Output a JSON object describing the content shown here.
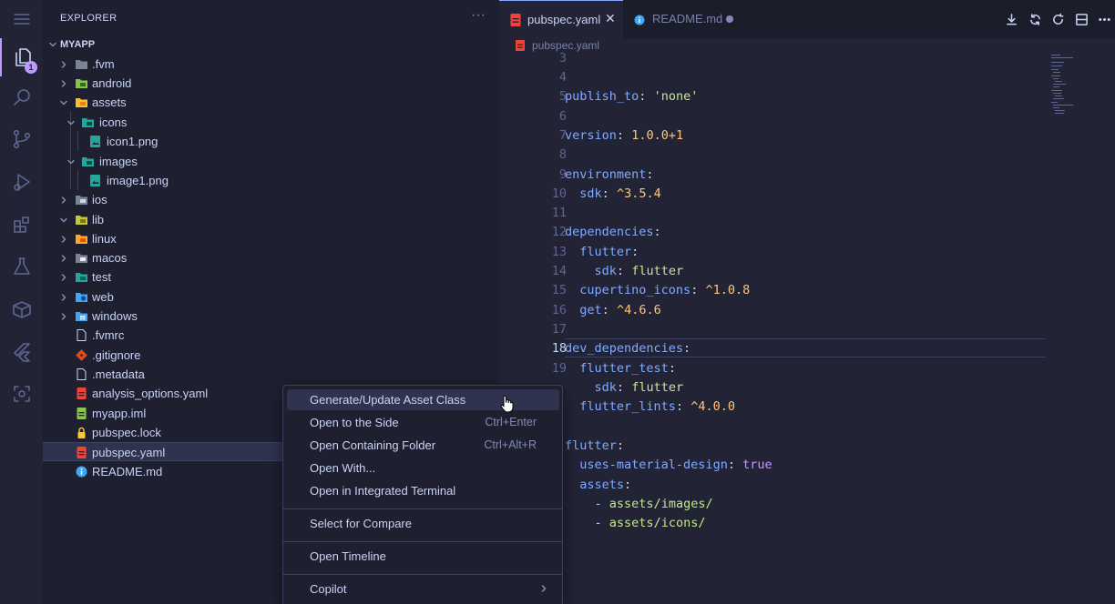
{
  "sidebar": {
    "title": "EXPLORER",
    "more": "···",
    "project": "MYAPP",
    "rows": [
      {
        "label": "assets"
      },
      {
        "label": "icons"
      },
      {
        "label": "icon1.png"
      },
      {
        "label": "images"
      },
      {
        "label": "image1.png"
      }
    ],
    "tree": {
      "fvm": ".fvm",
      "android": "android",
      "assets": "assets",
      "icons": "icons",
      "icon1": "icon1.png",
      "images": "images",
      "image1": "image1.png",
      "ios": "ios",
      "lib": "lib",
      "linux": "linux",
      "macos": "macos",
      "test": "test",
      "web": "web",
      "windows": "windows",
      "fvmrc": ".fvmrc",
      "gitignore": ".gitignore",
      "metadata": ".metadata",
      "analysis": "analysis_options.yaml",
      "myapp_iml": "myapp.iml",
      "pubspec_lock": "pubspec.lock",
      "pubspec_yaml": "pubspec.yaml",
      "readme": "README.md"
    }
  },
  "activity": {
    "badge": "1"
  },
  "tabs": {
    "t1": "pubspec.yaml",
    "t2": "README.md",
    "close": "✕"
  },
  "breadcrumb": "pubspec.yaml",
  "code": {
    "l3": "3",
    "l4": "4",
    "l5": "5",
    "l6": "6",
    "l7": "7",
    "l8": "8",
    "l9": "9",
    "l10": "10",
    "l11": "11",
    "l12": "12",
    "l13": "13",
    "l14": "14",
    "l15": "15",
    "l16": "16",
    "l17": "17",
    "l18": "18",
    "l19": "19",
    "publish_key": "publish_to",
    "publish_val": "'none'",
    "version_key": "version",
    "version_val": "1.0.0+1",
    "env_key": "environment",
    "sdk_key": "sdk",
    "sdk_val": "^3.5.4",
    "deps_key": "dependencies",
    "flutter_key": "flutter",
    "sdk2_key": "sdk",
    "sdk2_val": "flutter",
    "cup_key": "cupertino_icons",
    "cup_val": "^1.0.8",
    "get_key": "get",
    "get_val": "^4.6.6",
    "dev_key": "dev_dependencies",
    "ft_key": "flutter_test",
    "sdk3_key": "sdk",
    "sdk3_val": "flutter",
    "fl_key": "flutter_lints",
    "fl_val": "^4.0.0",
    "flutter2_key": "flutter",
    "umd_key": "uses-material-design",
    "umd_val": "true",
    "assets_key": "assets",
    "dash": "-",
    "asset1": "assets/images/",
    "asset2": "assets/icons/",
    "colon": ":"
  },
  "menu": {
    "gen": "Generate/Update Asset Class",
    "side": "Open to the Side",
    "side_sc": "Ctrl+Enter",
    "folder": "Open Containing Folder",
    "folder_sc": "Ctrl+Alt+R",
    "with": "Open With...",
    "terminal": "Open in Integrated Terminal",
    "compare": "Select for Compare",
    "timeline": "Open Timeline",
    "copilot": "Copilot"
  },
  "colors": {
    "accent": "#82aaff",
    "key": "#82aaff",
    "string": "#c3e88d",
    "number": "#ffc777",
    "bool": "#c099ff"
  }
}
